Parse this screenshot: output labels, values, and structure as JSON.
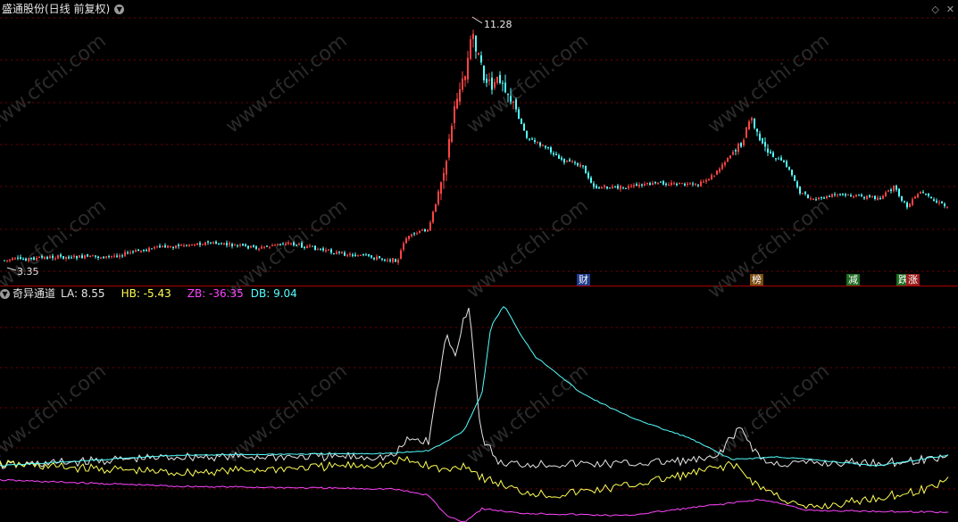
{
  "price_panel": {
    "title": "盛通股份(日线 前复权)",
    "dropdown_icon": "chevron-down-icon",
    "max_label": "11.28",
    "min_label": "3.35",
    "colors": {
      "up": "#ff4444",
      "down": "#54ffff",
      "grid": "#7a0000",
      "border": "#b00000"
    }
  },
  "top_controls": {
    "icons": [
      "diamond-icon",
      "close-icon"
    ]
  },
  "event_markers": [
    {
      "label": "财",
      "bg": "#1e3b8a",
      "fg": "#ffffff"
    },
    {
      "label": "榜",
      "bg": "#7a4a10",
      "fg": "#ffffff"
    },
    {
      "label": "减",
      "bg": "#1f6b22",
      "fg": "#ffffff"
    },
    {
      "label": "跌",
      "bg": "#1f6b22",
      "fg": "#ffffff"
    },
    {
      "label": "涨",
      "bg": "#9c1c1c",
      "fg": "#ffffff"
    }
  ],
  "indicator_panel": {
    "name": "奇异通道",
    "values": [
      {
        "label": "LA: 8.55",
        "color": "#e6e6e6"
      },
      {
        "label": "HB: -5.43",
        "color": "#ffff55"
      },
      {
        "label": "ZB: -36.35",
        "color": "#ff44ff"
      },
      {
        "label": "DB: 9.04",
        "color": "#55ffff"
      }
    ]
  },
  "watermark": "www.cfchi.com"
}
